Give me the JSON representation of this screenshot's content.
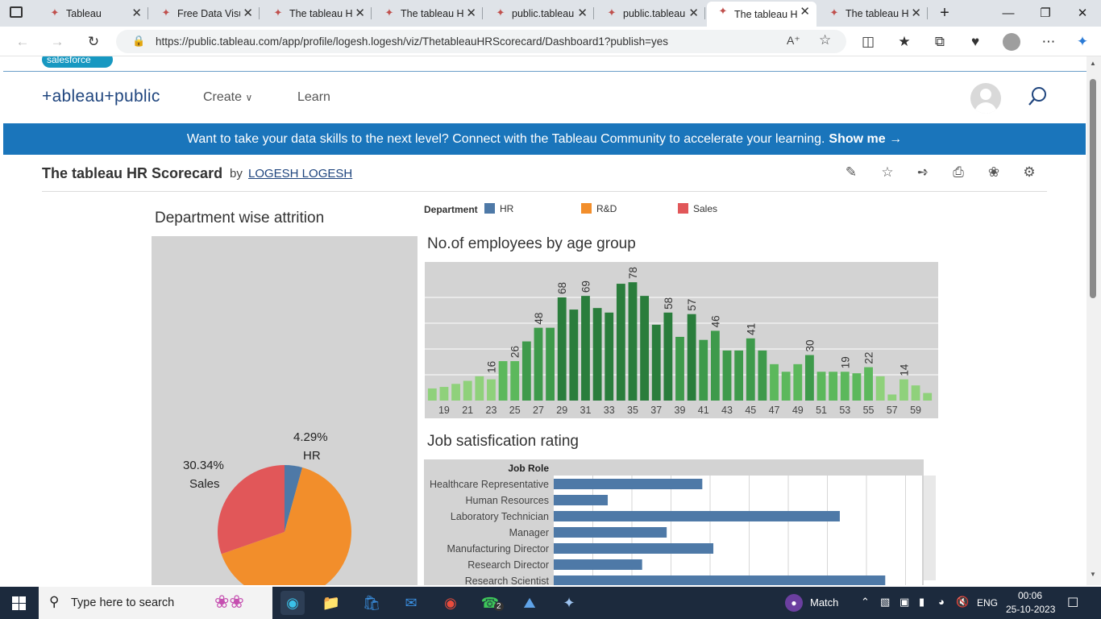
{
  "browser": {
    "tabs": [
      {
        "title": "Tableau",
        "icon": "tableau-icon"
      },
      {
        "title": "Free Data Visu",
        "icon": "tableau-icon"
      },
      {
        "title": "The tableau H",
        "icon": "tableau-icon"
      },
      {
        "title": "The tableau H",
        "icon": "tableau-icon"
      },
      {
        "title": "public.tableau",
        "icon": "tableau-icon"
      },
      {
        "title": "public.tableau",
        "icon": "tableau-icon"
      },
      {
        "title": "The tableau H",
        "icon": "tableau-icon",
        "active": true
      },
      {
        "title": "The tableau H",
        "icon": "tableau-icon"
      }
    ],
    "url": "https://public.tableau.com/app/profile/logesh.logesh/viz/ThetableauHRScorecard/Dashboard1?publish=yes"
  },
  "site": {
    "salesforce_label": "salesforce",
    "logo_text": "+ableau+public",
    "nav": {
      "create": "Create",
      "learn": "Learn"
    },
    "banner_text": "Want to take your data skills to the next level? Connect with the Tableau Community to accelerate your learning.",
    "banner_link": "Show me →"
  },
  "viz": {
    "title": "The tableau HR Scorecard",
    "by": "by",
    "author": "LOGESH LOGESH"
  },
  "dashboard": {
    "pie_title": "Department wise attrition",
    "age_title": "No.of employees by age group",
    "job_title": "Job satisfication rating",
    "legend_title": "Department",
    "legend": [
      {
        "label": "HR",
        "color": "#4e79a7"
      },
      {
        "label": "R&D",
        "color": "#f28e2b"
      },
      {
        "label": "Sales",
        "color": "#e15759"
      }
    ],
    "pie_labels": {
      "hr_pct": "4.29%",
      "hr_name": "HR",
      "sales_pct": "30.34%",
      "sales_name": "Sales"
    },
    "job_axis_title": "Job Role"
  },
  "chart_data": [
    {
      "type": "pie",
      "title": "Department wise attrition",
      "slices": [
        {
          "label": "HR",
          "value": 4.29,
          "color": "#4e79a7"
        },
        {
          "label": "R&D",
          "value": 65.37,
          "color": "#f28e2b"
        },
        {
          "label": "Sales",
          "value": 30.34,
          "color": "#e15759"
        }
      ]
    },
    {
      "type": "bar",
      "title": "No.of employees by age group",
      "x": [
        18,
        19,
        20,
        21,
        22,
        23,
        24,
        25,
        26,
        27,
        28,
        29,
        30,
        31,
        32,
        33,
        34,
        35,
        36,
        37,
        38,
        39,
        40,
        41,
        42,
        43,
        44,
        45,
        46,
        47,
        48,
        49,
        50,
        51,
        52,
        53,
        54,
        55,
        56,
        57,
        58,
        59,
        60
      ],
      "values": [
        8,
        9,
        11,
        13,
        16,
        14,
        26,
        26,
        39,
        48,
        48,
        68,
        60,
        69,
        61,
        58,
        77,
        78,
        69,
        50,
        58,
        42,
        57,
        40,
        46,
        33,
        33,
        41,
        33,
        24,
        19,
        24,
        30,
        19,
        19,
        19,
        18,
        22,
        16,
        4,
        14,
        10,
        5
      ],
      "tick_labels": [
        "19",
        "21",
        "23",
        "25",
        "27",
        "29",
        "31",
        "33",
        "35",
        "37",
        "39",
        "41",
        "43",
        "45",
        "47",
        "49",
        "51",
        "53",
        "55",
        "57",
        "59"
      ],
      "data_labels": [
        {
          "x": 23,
          "value": 16
        },
        {
          "x": 25,
          "value": 26
        },
        {
          "x": 27,
          "value": 48
        },
        {
          "x": 29,
          "value": 68
        },
        {
          "x": 31,
          "value": 69
        },
        {
          "x": 35,
          "value": 78
        },
        {
          "x": 38,
          "value": 58
        },
        {
          "x": 40,
          "value": 57
        },
        {
          "x": 42,
          "value": 46
        },
        {
          "x": 45,
          "value": 41
        },
        {
          "x": 50,
          "value": 30
        },
        {
          "x": 53,
          "value": 19
        },
        {
          "x": 55,
          "value": 22
        },
        {
          "x": 58,
          "value": 14
        }
      ],
      "ylim": [
        0,
        85
      ]
    },
    {
      "type": "bar",
      "orientation": "horizontal",
      "title": "Job satisfication rating",
      "axis_title": "Job Role",
      "categories": [
        "Healthcare Representative",
        "Human Resources",
        "Laboratory Technician",
        "Manager",
        "Manufacturing Director",
        "Research Director",
        "Research Scientist"
      ],
      "values": [
        121,
        44,
        233,
        92,
        130,
        72,
        270
      ],
      "xlim": [
        0,
        300
      ]
    }
  ],
  "taskbar": {
    "search_placeholder": "Type here to search",
    "weather_text": "Match",
    "language": "ENG",
    "time": "00:06",
    "date": "25-10-2023",
    "whatsapp_badge": "2"
  }
}
